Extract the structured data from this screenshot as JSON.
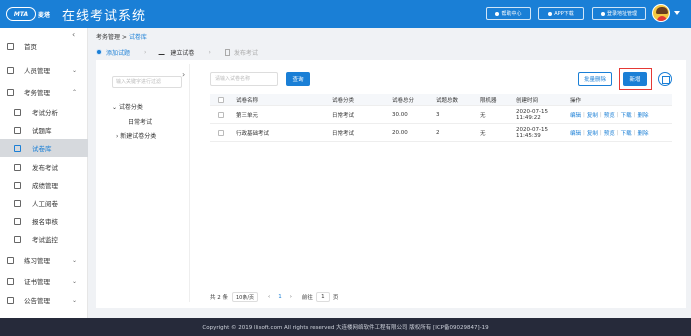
{
  "header": {
    "logo_mark": "MTA",
    "logo_sub": "麦塔",
    "title": "在线考试系统",
    "buttons": [
      "帮助中心",
      "APP下载",
      "登录地址管理"
    ]
  },
  "sidebar": {
    "collapse": "‹",
    "items": [
      {
        "label": "首页",
        "icon": "home-icon",
        "arrow": ""
      },
      {
        "label": "人员管理",
        "icon": "user-icon",
        "arrow": "⌄"
      },
      {
        "label": "考务管理",
        "icon": "exam-icon",
        "arrow": "⌃"
      },
      {
        "label": "考试分析",
        "icon": "analysis-icon",
        "arrow": "",
        "sub": true
      },
      {
        "label": "试题库",
        "icon": "question-bank-icon",
        "arrow": "",
        "sub": true
      },
      {
        "label": "试卷库",
        "icon": "paper-bank-icon",
        "arrow": "",
        "sub": true,
        "active": true
      },
      {
        "label": "发布考试",
        "icon": "publish-icon",
        "arrow": "",
        "sub": true
      },
      {
        "label": "成绩管理",
        "icon": "score-icon",
        "arrow": "",
        "sub": true
      },
      {
        "label": "人工阅卷",
        "icon": "grading-icon",
        "arrow": "",
        "sub": true
      },
      {
        "label": "报名审核",
        "icon": "audit-icon",
        "arrow": "",
        "sub": true
      },
      {
        "label": "考试监控",
        "icon": "monitor-icon",
        "arrow": "",
        "sub": true
      },
      {
        "label": "练习管理",
        "icon": "practice-icon",
        "arrow": "⌄"
      },
      {
        "label": "证书管理",
        "icon": "certificate-icon",
        "arrow": "⌄"
      },
      {
        "label": "公告管理",
        "icon": "notice-icon",
        "arrow": "⌄"
      }
    ]
  },
  "breadcrumb": {
    "parent": "考务管理",
    "sep": " > ",
    "current": "试卷库"
  },
  "steps": [
    {
      "label": "添加试题",
      "state": "active"
    },
    {
      "label": "建立试卷",
      "state": "normal"
    },
    {
      "label": "发布考试",
      "state": "pending"
    }
  ],
  "tree": {
    "search_placeholder": "输入关键字进行过滤",
    "collapse": "›",
    "root": "⌄ 试卷分类",
    "child1": "日常考试",
    "child2": "› 新建试卷分类"
  },
  "toolbar": {
    "search_placeholder": "请输入试卷名称",
    "query": "查询",
    "batch_delete": "批量删除",
    "new": "新增"
  },
  "table": {
    "headers": [
      "试卷名称",
      "试卷分类",
      "试卷总分",
      "试题总数",
      "限机器",
      "创建时间",
      "操作"
    ],
    "rows": [
      [
        "第三单元",
        "日常考试",
        "30.00",
        "3",
        "无",
        "2020-07-15 11:49:22"
      ],
      [
        "行政基础考试",
        "日常考试",
        "20.00",
        "2",
        "无",
        "2020-07-15 11:45:39"
      ]
    ],
    "ops": [
      "编辑",
      "复制",
      "预览",
      "下载",
      "删除"
    ]
  },
  "pager": {
    "total": "共 2 条",
    "page_size": "10条/页",
    "prev": "‹",
    "current": "1",
    "next": "›",
    "goto": "前往",
    "goto_value": "1",
    "page_unit": "页"
  },
  "footer": {
    "text": "Copyright © 2019 llisoft.com All rights reserved 大连楼网络软件工程有限公司 版权所有 [ICP备09029847]-19"
  }
}
